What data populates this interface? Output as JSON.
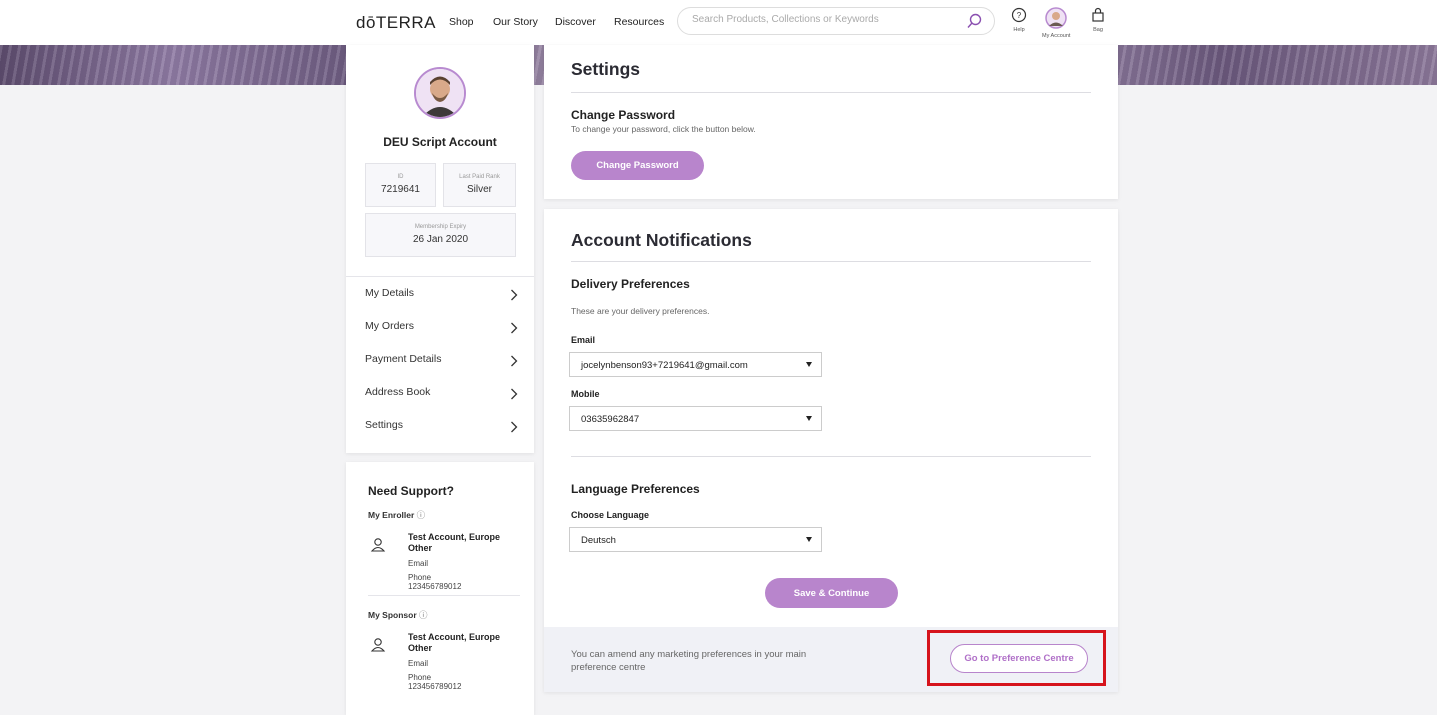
{
  "header": {
    "logo": "dōTERRA",
    "nav": [
      "Shop",
      "Our Story",
      "Discover",
      "Resources"
    ],
    "search_placeholder": "Search Products, Collections or Keywords",
    "help_label": "Help",
    "account_label": "My Account",
    "bag_label": "Bag"
  },
  "profile": {
    "name": "DEU Script Account",
    "id_label": "ID",
    "id_value": "7219641",
    "rank_label": "Last Paid Rank",
    "rank_value": "Silver",
    "expiry_label": "Membership Expiry",
    "expiry_value": "26 Jan 2020"
  },
  "sidebar": {
    "items": [
      {
        "label": "My Details"
      },
      {
        "label": "My Orders"
      },
      {
        "label": "Payment Details"
      },
      {
        "label": "Address Book"
      },
      {
        "label": "Settings"
      }
    ]
  },
  "support": {
    "title": "Need Support?",
    "enroller_label": "My Enroller",
    "enroller": {
      "name": "Test Account, Europe Other",
      "email": "Email",
      "phone": "Phone 123456789012"
    },
    "sponsor_label": "My Sponsor",
    "sponsor": {
      "name": "Test Account, Europe Other",
      "email": "Email",
      "phone": "Phone 123456789012"
    }
  },
  "settings": {
    "title": "Settings",
    "change_password_heading": "Change Password",
    "change_password_desc": "To change your password, click the button below.",
    "change_password_button": "Change Password"
  },
  "notifications": {
    "title": "Account Notifications",
    "delivery_heading": "Delivery Preferences",
    "delivery_desc": "These are your delivery preferences.",
    "email_label": "Email",
    "email_value": "jocelynbenson93+7219641@gmail.com",
    "mobile_label": "Mobile",
    "mobile_value": "03635962847",
    "language_heading": "Language Preferences",
    "language_label": "Choose Language",
    "language_value": "Deutsch",
    "save_button": "Save & Continue",
    "footer_text": "You can amend any marketing preferences in your main preference centre",
    "preference_button": "Go to Preference Centre"
  },
  "colors": {
    "accent": "#b885cc",
    "highlight": "#d6141c"
  }
}
